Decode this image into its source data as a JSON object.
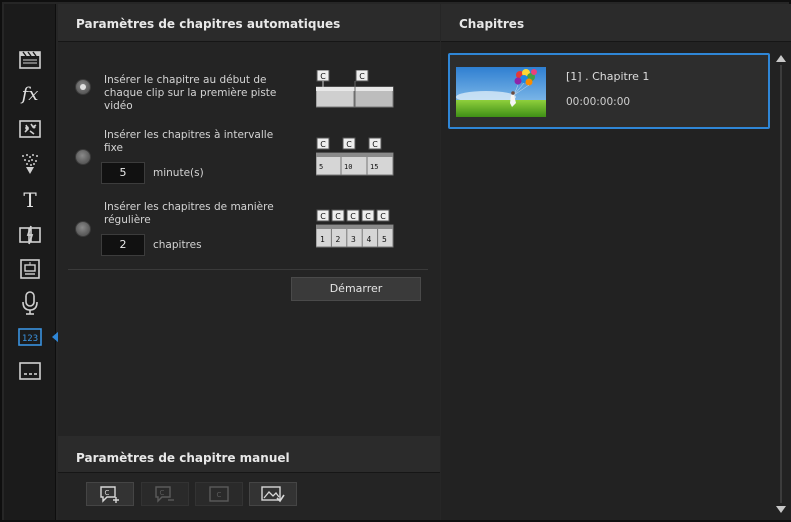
{
  "auto_settings": {
    "header": "Paramètres de chapitres automatiques",
    "option1": {
      "label": "Insérer le chapitre au début de chaque clip sur la première piste vidéo",
      "selected": true
    },
    "option2": {
      "label": "Insérer les chapitres à intervalle fixe",
      "value": "5",
      "unit": "minute(s)",
      "selected": false,
      "ticks": [
        "5",
        "10",
        "15"
      ]
    },
    "option3": {
      "label": "Insérer les chapitres de manière régulière",
      "value": "2",
      "unit": "chapitres",
      "selected": false,
      "ticks": [
        "1",
        "2",
        "3",
        "4",
        "5"
      ]
    },
    "marker_letter": "C",
    "start_button": "Démarrer"
  },
  "manual_settings": {
    "header": "Paramètres de chapitre manuel",
    "tools": [
      {
        "icon": "add-chapter-icon",
        "enabled": true
      },
      {
        "icon": "remove-chapter-icon",
        "enabled": false
      },
      {
        "icon": "go-to-chapter-icon",
        "enabled": false
      },
      {
        "icon": "set-thumbnail-icon",
        "enabled": true
      }
    ]
  },
  "chapters": {
    "header": "Chapitres",
    "items": [
      {
        "title": "[1] . Chapitre 1",
        "time": "00:00:00:00",
        "thumbnail": "balloons-girl-field"
      }
    ]
  },
  "toolbar": {
    "tools": [
      "media-room-icon",
      "fx-icon",
      "pip-objects-icon",
      "particle-icon",
      "title-icon",
      "transition-icon",
      "subtitle-room-icon",
      "voice-over-icon",
      "chapter-room-icon",
      "subtitle-icon"
    ],
    "active": "chapter-room-icon",
    "fx_label": "fx",
    "title_label": "T",
    "chapter_icon_text": "123"
  },
  "colors": {
    "accent": "#2f86d6",
    "panel": "#242424",
    "header": "#2b2b2b"
  }
}
